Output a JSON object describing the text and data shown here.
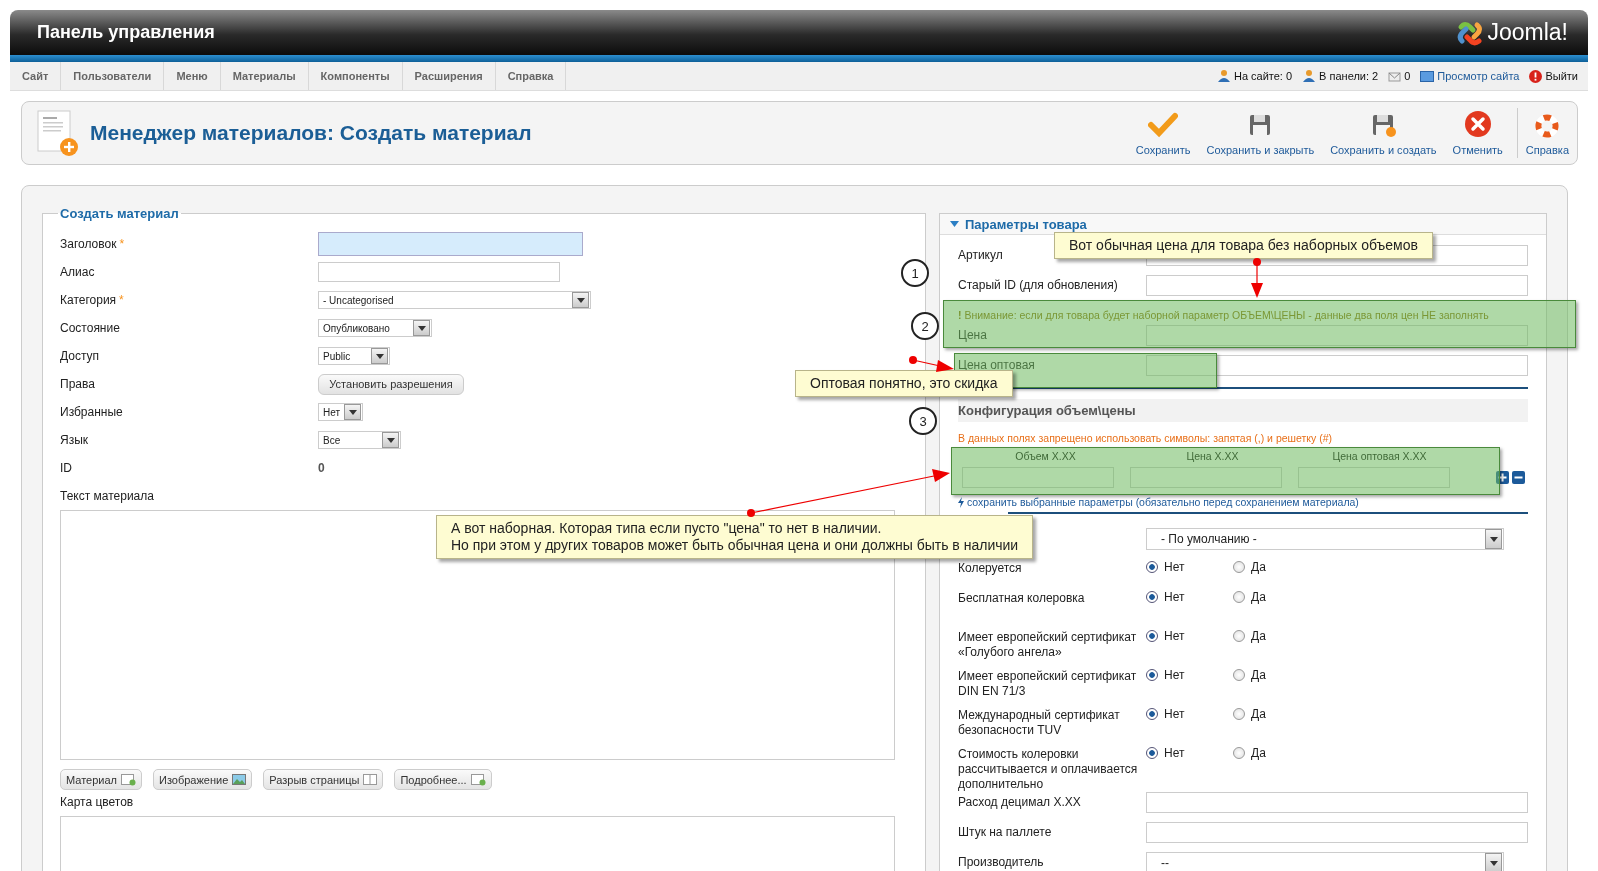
{
  "header": {
    "title": "Панель управления",
    "logo": "Joomla!"
  },
  "menu": [
    "Сайт",
    "Пользователи",
    "Меню",
    "Материалы",
    "Компоненты",
    "Расширения",
    "Справка"
  ],
  "status": [
    {
      "kind": "users",
      "text": "На сайте: 0"
    },
    {
      "kind": "users",
      "text": "В панели: 2"
    },
    {
      "kind": "mail",
      "text": "0"
    },
    {
      "kind": "link",
      "text": "Просмотр сайта"
    },
    {
      "kind": "logout",
      "text": "Выйти"
    }
  ],
  "page_title": "Менеджер материалов: Создать материал",
  "toolbar": [
    {
      "kind": "check",
      "label": "Сохранить"
    },
    {
      "kind": "save",
      "label": "Сохранить и закрыть"
    },
    {
      "kind": "save-new",
      "label": "Сохранить и создать"
    },
    {
      "kind": "cancel",
      "label": "Отменить"
    },
    {
      "kind": "help",
      "label": "Справка"
    }
  ],
  "form": {
    "legend": "Создать материал",
    "fields": [
      {
        "kind": "text",
        "label": "Заголовок",
        "mark": "*",
        "focused": true
      },
      {
        "kind": "text",
        "label": "Алиас",
        "focused": false
      },
      {
        "kind": "select",
        "label": "Категория",
        "mark": "*",
        "value": "- Uncategorised"
      },
      {
        "kind": "select",
        "label": "Состояние",
        "value": "Опубликовано"
      },
      {
        "kind": "select",
        "label": "Доступ",
        "value": "Public"
      },
      {
        "kind": "button",
        "label": "Права",
        "value": "Установить разрешения"
      },
      {
        "kind": "select",
        "label": "Избранные",
        "value": "Нет"
      },
      {
        "kind": "select",
        "label": "Язык",
        "value": "Все"
      },
      {
        "kind": "value",
        "label": "ID",
        "value": "0"
      }
    ],
    "editor_label": "Текст материала",
    "editor_buttons": [
      {
        "kind": "doc",
        "label": "Материал"
      },
      {
        "kind": "image",
        "label": "Изображение"
      },
      {
        "kind": "pagebreak",
        "label": "Разрыв страницы"
      },
      {
        "kind": "doc",
        "label": "Подробнее..."
      }
    ],
    "colormap_label": "Карта цветов"
  },
  "params": {
    "title": "Параметры товара",
    "expanded": true,
    "rows": [
      {
        "kind": "text",
        "label": "Артикул"
      },
      {
        "kind": "text",
        "label": "Старый ID (для обновления)"
      },
      {
        "kind": "warning",
        "text": "**!** Внимание: если для товара будет наборной параметр ОБЪЕМ\\ЦЕНЫ - данные два поля цен НЕ заполнять"
      },
      {
        "kind": "text",
        "label": "Цена"
      },
      {
        "kind": "text",
        "label": "Цена оптовая"
      },
      {
        "kind": "section",
        "text": "Конфигурация объем\\цены"
      },
      {
        "kind": "note",
        "text": "В данных полях запрещено использовать символы: запятая (,) и решетку (#)"
      },
      {
        "kind": "columns",
        "columns": [
          "Объем X.XX",
          "Цена X.XX",
          "Цена оптовая X.XX"
        ]
      },
      {
        "kind": "link",
        "text": "сохранить выбранные параметры (обязательно перед сохранением материала)"
      },
      {
        "kind": "select",
        "value": "- По умолчанию -"
      },
      {
        "kind": "radio",
        "label": "Колеруется",
        "options": [
          {
            "label": "Нет",
            "selected": true
          },
          {
            "label": "Да",
            "selected": false
          }
        ]
      },
      {
        "kind": "radio",
        "label": "Бесплатная колеровка",
        "options": [
          {
            "label": "Нет",
            "selected": true
          },
          {
            "label": "Да",
            "selected": false
          }
        ]
      },
      {
        "kind": "radio",
        "label": "Имеет европейский сертификат «Голубого ангела»",
        "options": [
          {
            "label": "Нет",
            "selected": true
          },
          {
            "label": "Да",
            "selected": false
          }
        ]
      },
      {
        "kind": "radio",
        "label": "Имеет европейский сертификат DIN EN 71/3",
        "options": [
          {
            "label": "Нет",
            "selected": true
          },
          {
            "label": "Да",
            "selected": false
          }
        ]
      },
      {
        "kind": "radio",
        "label": "Международный сертификат безопасности TUV",
        "options": [
          {
            "label": "Нет",
            "selected": true
          },
          {
            "label": "Да",
            "selected": false
          }
        ]
      },
      {
        "kind": "radio",
        "label": "Стоимость колеровки рассчитывается и оплачивается дополнительно",
        "options": [
          {
            "label": "Нет",
            "selected": true
          },
          {
            "label": "Да",
            "selected": false
          }
        ]
      },
      {
        "kind": "text",
        "label": "Расход децимал X.XX"
      },
      {
        "kind": "text",
        "label": "Штук на паллете"
      },
      {
        "kind": "select",
        "label": "Производитель",
        "value": "--"
      }
    ]
  },
  "annotations": {
    "markers": [
      "1",
      "2",
      "3"
    ],
    "callouts": [
      {
        "lines": [
          "Вот обычная цена для товара без наборных объемов"
        ]
      },
      {
        "lines": [
          "Оптовая понятно, это скидка"
        ]
      },
      {
        "lines": [
          "А вот наборная.  Которая типа если пусто \"цена\" то нет в наличии.",
          "Но при этом у других товаров может быть обычная цена и они должны быть в наличии"
        ]
      }
    ]
  }
}
